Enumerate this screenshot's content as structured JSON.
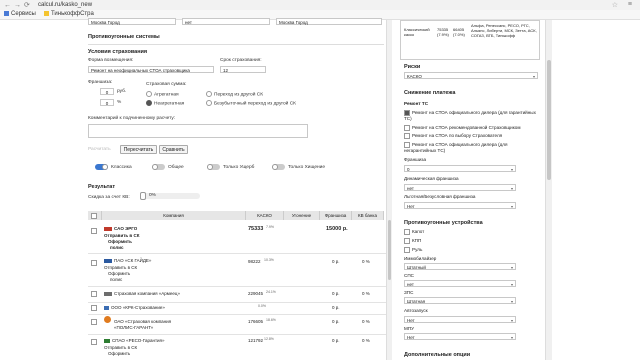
{
  "browser": {
    "url": "calcul.ru/kasko_new",
    "bookmarks": [
      "Сервисы",
      "ТинькоффСтра"
    ]
  },
  "top_fields": {
    "left": "Москва Город",
    "mid": "нет",
    "right": "Москва Город"
  },
  "form": {
    "antitheft_title": "Противоугонные системы",
    "conditions_title": "Условия страхования",
    "compensation_label": "Форма возмещения:",
    "compensation_value": "Ремонт на неофициальных СТОА страховщика",
    "term_label": "Срок страхования:",
    "term_value": "12",
    "franchise_label": "Франшиза:",
    "franchise_rub_value": "0",
    "franchise_rub_unit": "руб.",
    "franchise_pct_value": "0",
    "franchise_pct_unit": "%",
    "sum_label": "Страховая сумма:",
    "radio_aggregate": "Агрегатная",
    "radio_nonaggregate": "Неагрегатная",
    "radio_transfer": "Переход из другой СК",
    "radio_lossfree": "Безубыточный переход из другой СК",
    "comment_label": "Комментарий к подчиненному расчету:",
    "compare_faded": "Расчитать",
    "recalc_button": "Пересчитать",
    "compare_button": "Сравнить"
  },
  "toggles": {
    "classic": "Классика",
    "common": "Общее",
    "damage_only": "Только Ущерб",
    "theft_only": "Только Хищение"
  },
  "results": {
    "title": "Результат",
    "discount_label": "Скидка за счет КВ:",
    "discount_value": "0%",
    "columns": [
      "Компания",
      "КАСКО",
      "Угонение",
      "Франшиза",
      "КВ банка"
    ],
    "rows": [
      {
        "name": "САО ЭРГО",
        "sub1": "Отправить в СК",
        "sub2": "Оформить",
        "sub3": "полис",
        "kasko": "75333",
        "pct": "7.9%",
        "ugon": "",
        "franchise": "15000 р.",
        "kv": "0 %",
        "logo": "#c0392b",
        "bold": true
      },
      {
        "name": "ПАО «СК ГАЙДЕ»",
        "sub1": "Отправить в СК",
        "sub2": "Оформить",
        "sub3": "полис",
        "kasko": "98222",
        "pct": "10.3%",
        "ugon": "",
        "franchise": "0 р.",
        "kv": "0 %",
        "logo": "#2c5aa0",
        "bold": false
      },
      {
        "name": "Страховая компания «Армеец»",
        "sub1": "",
        "sub2": "",
        "sub3": "",
        "kasko": "229045",
        "pct": "24.1%",
        "ugon": "",
        "franchise": "0 р.",
        "kv": "0 %",
        "logo": "#6d6d6d",
        "bold": false
      },
      {
        "name": "ООО «КРК-Страхование»",
        "sub1": "",
        "sub2": "",
        "sub3": "",
        "kasko": "",
        "pct": "0.0%",
        "ugon": "",
        "franchise": "0 р.",
        "kv": "",
        "logo": "#3b6db3",
        "bold": false
      },
      {
        "name": "ОАО «Страховая компания «ПОЛИС-ГАРАНТ»",
        "sub1": "",
        "sub2": "",
        "sub3": "",
        "kasko": "176605",
        "pct": "18.6%",
        "ugon": "",
        "franchise": "0 р.",
        "kv": "0 %",
        "logo": "#e07b1f",
        "bold": false
      },
      {
        "name": "СПАО «РЕСО-Гарантия»",
        "sub1": "Отправить в СК",
        "sub2": "Оформить",
        "sub3": "",
        "kasko": "121792",
        "pct": "12.8%",
        "ugon": "",
        "franchise": "0 р.",
        "kv": "0 %",
        "logo": "#2e7d32",
        "bold": false
      }
    ]
  },
  "right_panel": {
    "mini_table": {
      "col1": "Классический каско",
      "col2": "75335 (7.9%)",
      "col3": "66405 (7.0%)",
      "col4": "Альфа, Ренессанс, РЕСО, РГС, Альянс, Либерти, МСК, Зетта, АСК, СОГАЗ, ВТБ, Тинькофф"
    },
    "risks_title": "Риски",
    "risks_value": "КАСКО",
    "reduce_title": "Снижение платежа",
    "repair_title": "Ремонт ТС",
    "repair_options": [
      {
        "label": "Ремонт на СТОА официального дилера (для гарантийных ТС)",
        "checked": true
      },
      {
        "label": "Ремонт на СТОА рекомендованной Страховщиком",
        "checked": false
      },
      {
        "label": "Ремонт на СТОА по выбору Страхователя",
        "checked": false
      },
      {
        "label": "Ремонт на СТОА официального дилера (для негарантийных ТС)",
        "checked": false
      }
    ],
    "franchise_label": "Франшиза",
    "franchise_value": "0",
    "dynamic_label": "Динамическая франшиза",
    "dynamic_value": "нет",
    "privileged_label": "Льготная/Безусловная франшиза",
    "privileged_value": "Нет",
    "antitheft_title": "Противоугонные устройства",
    "antitheft_checks": [
      "Капот",
      "КПП",
      "Руль"
    ],
    "immob_label": "Иммобилайзер",
    "immob_value": "Штатный",
    "sps_label": "СПС",
    "sps_value": "нет",
    "zps_label": "ЗПС",
    "zps_value": "Штатная",
    "autostart_label": "Автозапуск",
    "autostart_value": "Нет",
    "mpu_label": "МПУ",
    "mpu_value": "Нет",
    "extra_title": "Дополнительные опции"
  }
}
